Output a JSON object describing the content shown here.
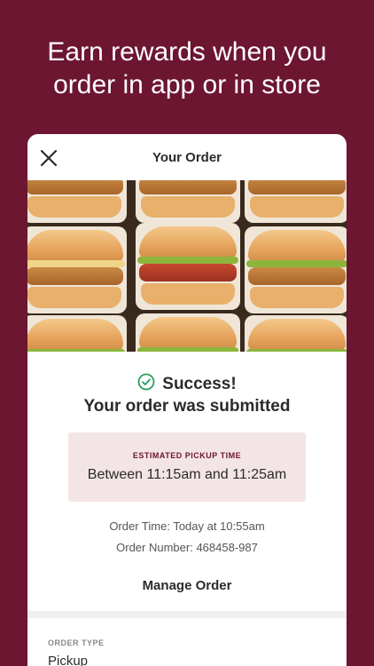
{
  "promo": {
    "headline_line1": "Earn rewards when you",
    "headline_line2": "order in app or in store"
  },
  "header": {
    "title": "Your Order",
    "close_icon": "close-icon"
  },
  "confirmation": {
    "success": "Success!",
    "message": "Your order was submitted",
    "status_icon": "check-circle-icon",
    "accent_color": "#2a9d5c"
  },
  "pickup": {
    "label": "ESTIMATED PICKUP TIME",
    "time": "Between 11:15am and 11:25am"
  },
  "details": {
    "order_time": "Order Time: Today at 10:55am",
    "order_number": "Order Number: 468458-987"
  },
  "actions": {
    "manage_label": "Manage Order"
  },
  "order_type": {
    "label": "ORDER TYPE",
    "value": "Pickup"
  },
  "colors": {
    "brand": "#6d1631",
    "pickup_box_bg": "#f3e5e6"
  }
}
